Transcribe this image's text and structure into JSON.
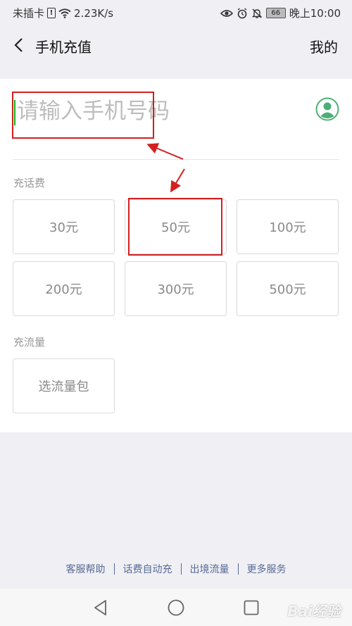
{
  "status_bar": {
    "carrier": "未插卡",
    "sim_mark": "!",
    "speed": "2.23K/s",
    "battery": "66",
    "time": "晚上10:00"
  },
  "header": {
    "title": "手机充值",
    "mine_label": "我的"
  },
  "phone_input": {
    "placeholder": "请输入手机号码",
    "value": ""
  },
  "recharge": {
    "label": "充话费",
    "options": [
      "30元",
      "50元",
      "100元",
      "200元",
      "300元",
      "500元"
    ]
  },
  "data_plan": {
    "label": "充流量",
    "option": "选流量包"
  },
  "footer_links": [
    "客服帮助",
    "话费自动充",
    "出境流量",
    "更多服务"
  ],
  "watermark": "Bai经验",
  "colors": {
    "accent_green": "#1aad19",
    "contact_icon": "#4caf76",
    "link_blue": "#576b95",
    "annotation_red": "#d42020"
  },
  "icons": {
    "back": "back-chevron-icon",
    "contact": "contact-person-icon",
    "wifi": "wifi-icon",
    "eye": "eye-icon",
    "alarm": "alarm-icon",
    "mute": "bell-off-icon",
    "nav_back": "triangle-back-icon",
    "nav_home": "circle-home-icon",
    "nav_recent": "square-recent-icon"
  }
}
